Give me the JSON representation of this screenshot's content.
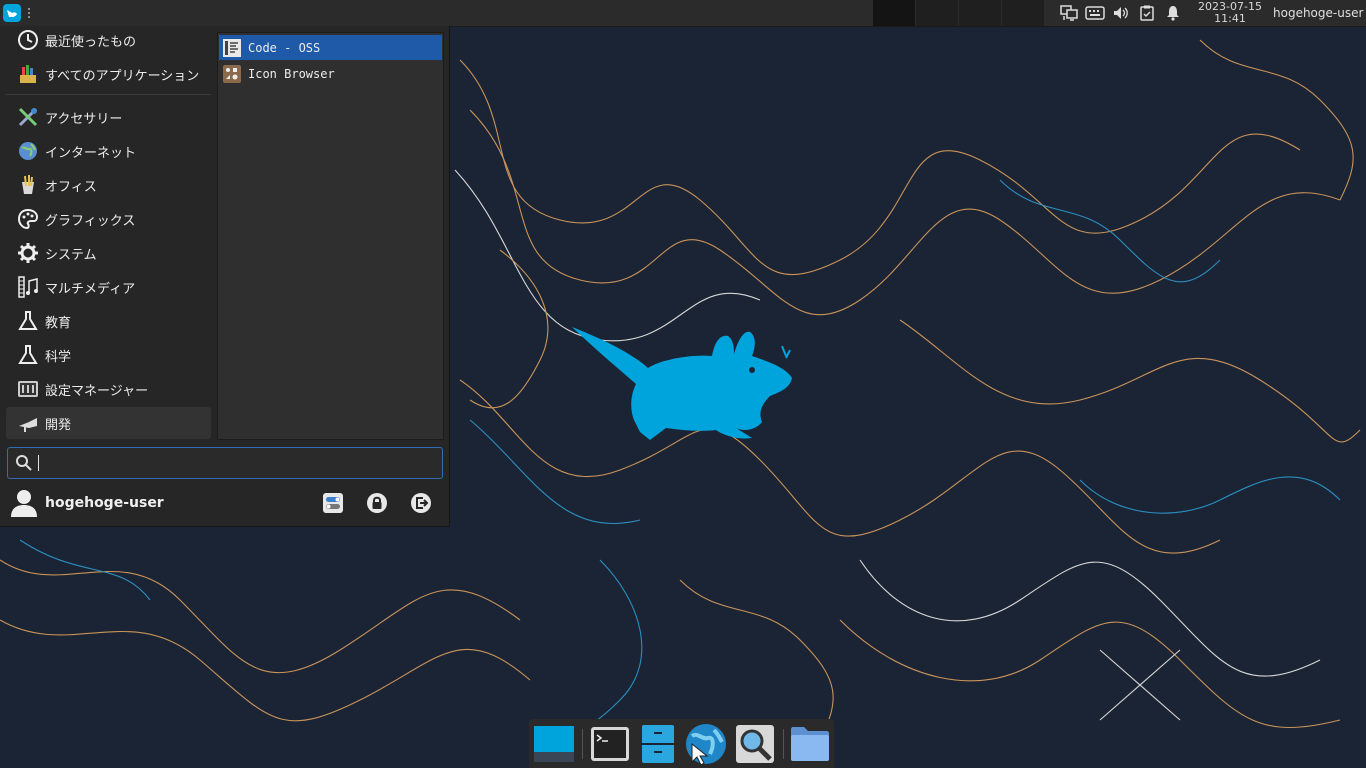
{
  "panel": {
    "clock_date": "2023-07-15",
    "clock_time": "11:41",
    "user_name": "hogehoge-user"
  },
  "menu": {
    "categories": [
      {
        "label": "最近使ったもの",
        "icon": "clock-icon"
      },
      {
        "label": "すべてのアプリケーション",
        "icon": "all-apps-icon"
      },
      {
        "label": "アクセサリー",
        "icon": "accessories-icon"
      },
      {
        "label": "インターネット",
        "icon": "globe-icon"
      },
      {
        "label": "オフィス",
        "icon": "office-icon"
      },
      {
        "label": "グラフィックス",
        "icon": "palette-icon"
      },
      {
        "label": "システム",
        "icon": "gear-icon"
      },
      {
        "label": "マルチメディア",
        "icon": "multimedia-icon"
      },
      {
        "label": "教育",
        "icon": "flask-icon"
      },
      {
        "label": "科学",
        "icon": "flask-icon"
      },
      {
        "label": "設定マネージャー",
        "icon": "settings-manager-icon"
      },
      {
        "label": "開発",
        "icon": "development-icon"
      }
    ],
    "selected_category": "開発",
    "apps": [
      {
        "label": "Code - OSS",
        "icon": "code-oss-icon",
        "selected": true
      },
      {
        "label": "Icon Browser",
        "icon": "icon-browser-icon",
        "selected": false
      }
    ],
    "search": {
      "value": "",
      "placeholder": ""
    },
    "user": {
      "name": "hogehoge-user"
    }
  },
  "dock": {
    "items": [
      "show-desktop-icon",
      "terminal-icon",
      "file-manager-icon",
      "web-browser-icon",
      "app-finder-icon",
      "folder-icon"
    ]
  },
  "colors": {
    "accent": "#1e5aa8",
    "xfce_blue": "#00a4dc",
    "wallpaper": "#1b2434"
  }
}
